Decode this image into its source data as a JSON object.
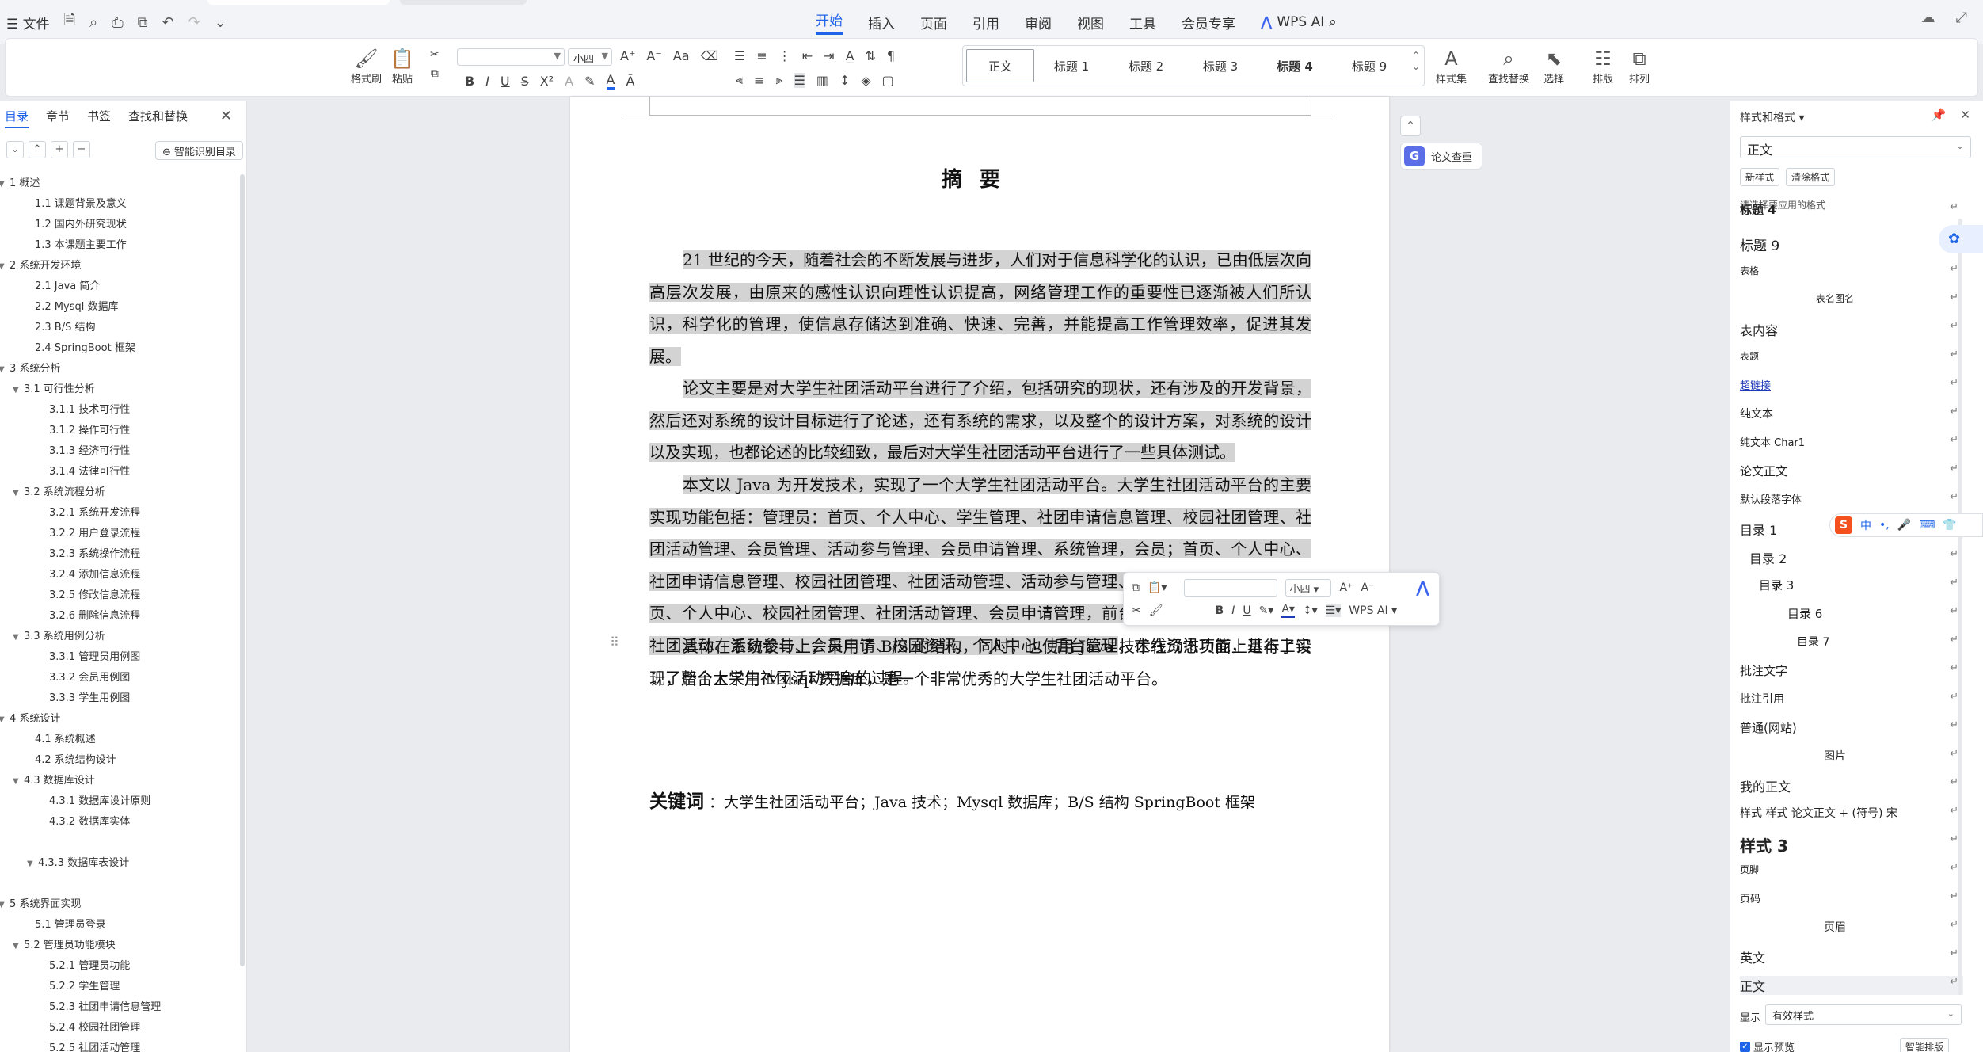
{
  "menubar": {
    "file": "文件",
    "tabs": [
      "开始",
      "插入",
      "页面",
      "引用",
      "审阅",
      "视图",
      "工具",
      "会员专享"
    ],
    "active_tab": "开始",
    "wps_ai": "WPS AI"
  },
  "ribbon": {
    "format_brush": "格式刷",
    "paste": "粘贴",
    "font_size": "小四",
    "styles": [
      "正文",
      "标题 1",
      "标题 2",
      "标题 3",
      "标题 4",
      "标题 9"
    ],
    "style_set": "样式集",
    "find_replace": "查找替换",
    "select": "选择",
    "layout": "排版",
    "arrange": "排列"
  },
  "nav": {
    "tabs": [
      "目录",
      "章节",
      "书签",
      "查找和替换"
    ],
    "smart_toc": "智能识别目录",
    "items": [
      {
        "label": "1  概述",
        "level": 1,
        "caret": true
      },
      {
        "label": "1.1 课题背景及意义",
        "level": 2
      },
      {
        "label": "1.2  国内外研究现状",
        "level": 2
      },
      {
        "label": "1.3  本课题主要工作",
        "level": 2
      },
      {
        "label": "2  系统开发环境",
        "level": 1,
        "caret": true
      },
      {
        "label": "2.1 Java 简介",
        "level": 2
      },
      {
        "label": "2.2 Mysql 数据库",
        "level": 2
      },
      {
        "label": "2.3 B/S 结构",
        "level": 2
      },
      {
        "label": "2.4 SpringBoot 框架",
        "level": 2
      },
      {
        "label": "3  系统分析",
        "level": 1,
        "caret": true
      },
      {
        "label": "3.1  可行性分析",
        "level": 2,
        "caret": true
      },
      {
        "label": "3.1.1  技术可行性",
        "level": 3
      },
      {
        "label": "3.1.2 操作可行性",
        "level": 3
      },
      {
        "label": "3.1.3  经济可行性",
        "level": 3
      },
      {
        "label": "3.1.4  法律可行性",
        "level": 3
      },
      {
        "label": "3.2 系统流程分析",
        "level": 2,
        "caret": true
      },
      {
        "label": "3.2.1 系统开发流程",
        "level": 3
      },
      {
        "label": "3.2.2  用户登录流程",
        "level": 3
      },
      {
        "label": "3.2.3  系统操作流程",
        "level": 3
      },
      {
        "label": "3.2.4  添加信息流程",
        "level": 3
      },
      {
        "label": "3.2.5  修改信息流程",
        "level": 3
      },
      {
        "label": "3.2.6  删除信息流程",
        "level": 3
      },
      {
        "label": "3.3 系统用例分析",
        "level": 2,
        "caret": true
      },
      {
        "label": "3.3.1 管理员用例图",
        "level": 3
      },
      {
        "label": "3.3.2 会员用例图",
        "level": 3
      },
      {
        "label": "3.3.3 学生用例图",
        "level": 3
      },
      {
        "label": "4  系统设计",
        "level": 1,
        "caret": true
      },
      {
        "label": "4.1  系统概述",
        "level": 2
      },
      {
        "label": "4.2  系统结构设计",
        "level": 2
      },
      {
        "label": "4.3 数据库设计",
        "level": 2,
        "caret": true
      },
      {
        "label": "4.3.1  数据库设计原则",
        "level": 3
      },
      {
        "label": "4.3.2  数据库实体",
        "level": 3
      },
      {
        "label": "4.3.3  数据库表设计",
        "level": 3,
        "caret": true
      },
      {
        "label": "5 系统界面实现",
        "level": 1,
        "caret": true
      },
      {
        "label": "5.1  管理员登录",
        "level": 2
      },
      {
        "label": "5.2    管理员功能模块",
        "level": 2,
        "caret": true
      },
      {
        "label": "5.2.1  管理员功能",
        "level": 3
      },
      {
        "label": "5.2.2 学生管理",
        "level": 3
      },
      {
        "label": "5.2.3  社团申请信息管理",
        "level": 3
      },
      {
        "label": "5.2.4 校园社团管理",
        "level": 3
      },
      {
        "label": "5.2.5 社团活动管理",
        "level": 3
      }
    ]
  },
  "doc": {
    "title": "摘要",
    "p1": "21 世纪的今天，随着社会的不断发展与进步，人们对于信息科学化的认识，已由低层次向高层次发展，由原来的感性认识向理性认识提高，网络管理工作的重要性已逐渐被人们所认识，科学化的管理，使信息存储达到准确、快速、完善，并能提高工作管理效率，促进其发展。",
    "p2": "论文主要是对大学生社团活动平台进行了介绍，包括研究的现状，还有涉及的开发背景，然后还对系统的设计目标进行了论述，还有系统的需求，以及整个的设计方案，对系统的设计以及实现，也都论述的比较细致，最后对大学生社团活动平台进行了一些具体测试。",
    "p3_hl": "本文以 Java 为开发技术，实现了一个大学生社团活动平台。大学生社团活动平台的主要实现功能包括：管理员：首页、个人中心、学生管理、社团申请信息管理、校园社团管理、社团活动管理、会员管理、活动参与管理、会员申请管理、系统管理，会员；首页、个人中心、社团申请信息管理、校园社团管理、社团活动管理、活动参与管理、会员申请管理，学生；首页、个人中心、校园社团管理、社团活动管理、会员申请管理，前台首页；首页、校园社团、社团活动、活动参与、会员申请、校园资讯、个人中心、后台管理",
    "p3_rest": "、在线资讯功能，基本上实现了整个大学生社团活动平台的过程。",
    "p4": "具体在系统设计上，采用了 B/S 的结构，同时，也使用 Java 技术在动态页面上进行了设计，后台上采用 Mysql 数据库，是一个非常优秀的大学生社团活动平台。",
    "kw_label": "关键词",
    "kw_text": "：大学生社团活动平台；Java 技术；Mysql 数据库；B/S 结构  SpringBoot 框架"
  },
  "minibar": {
    "font_size": "小四",
    "wps_ai": "WPS AI"
  },
  "side": {
    "check": "论文查重"
  },
  "stylepane": {
    "title": "样式和格式",
    "current": "正文",
    "new_style": "新样式",
    "clear_format": "清除格式",
    "hint": "请选择要应用的格式",
    "items": [
      {
        "label": "标题 4",
        "cls": "bold"
      },
      {
        "label": "标题  9",
        "size": 17
      },
      {
        "label": "表格",
        "size": 12
      },
      {
        "label": "表名图名",
        "size": 12,
        "center": true
      },
      {
        "label": "表内容",
        "size": 16
      },
      {
        "label": "表题",
        "size": 12
      },
      {
        "label": "超链接",
        "size": 13,
        "link": true
      },
      {
        "label": "纯文本",
        "size": 14
      },
      {
        "label": "纯文本 Char1",
        "size": 13
      },
      {
        "label": "论文正文",
        "size": 15
      },
      {
        "label": "默认段落字体",
        "size": 13
      },
      {
        "label": "目录 1",
        "size": 16
      },
      {
        "label": "目录 2",
        "size": 16,
        "indent": 12
      },
      {
        "label": "目录 3",
        "size": 15,
        "indent": 24
      },
      {
        "label": "目录 6",
        "size": 15,
        "indent": 60
      },
      {
        "label": "目录 7",
        "size": 14,
        "indent": 72
      },
      {
        "label": "批注文字",
        "size": 15
      },
      {
        "label": "批注引用",
        "size": 14
      },
      {
        "label": "普通(网站)",
        "size": 15
      },
      {
        "label": "图片",
        "size": 14,
        "center": true
      },
      {
        "label": "我的正文",
        "size": 16
      },
      {
        "label": "样式  样式  论文正文 + (符号) 宋",
        "size": 14
      },
      {
        "label": "样式 3",
        "size": 20,
        "cls": "bold"
      },
      {
        "label": "页脚",
        "size": 12
      },
      {
        "label": "页码",
        "size": 13
      },
      {
        "label": "页眉",
        "size": 14,
        "center": true
      },
      {
        "label": "英文",
        "size": 16
      },
      {
        "label": "正文",
        "size": 16,
        "sel": true
      }
    ],
    "show_label": "显示",
    "show_value": "有效样式",
    "show_preview": "显示预览",
    "smart_layout": "智能排版"
  }
}
